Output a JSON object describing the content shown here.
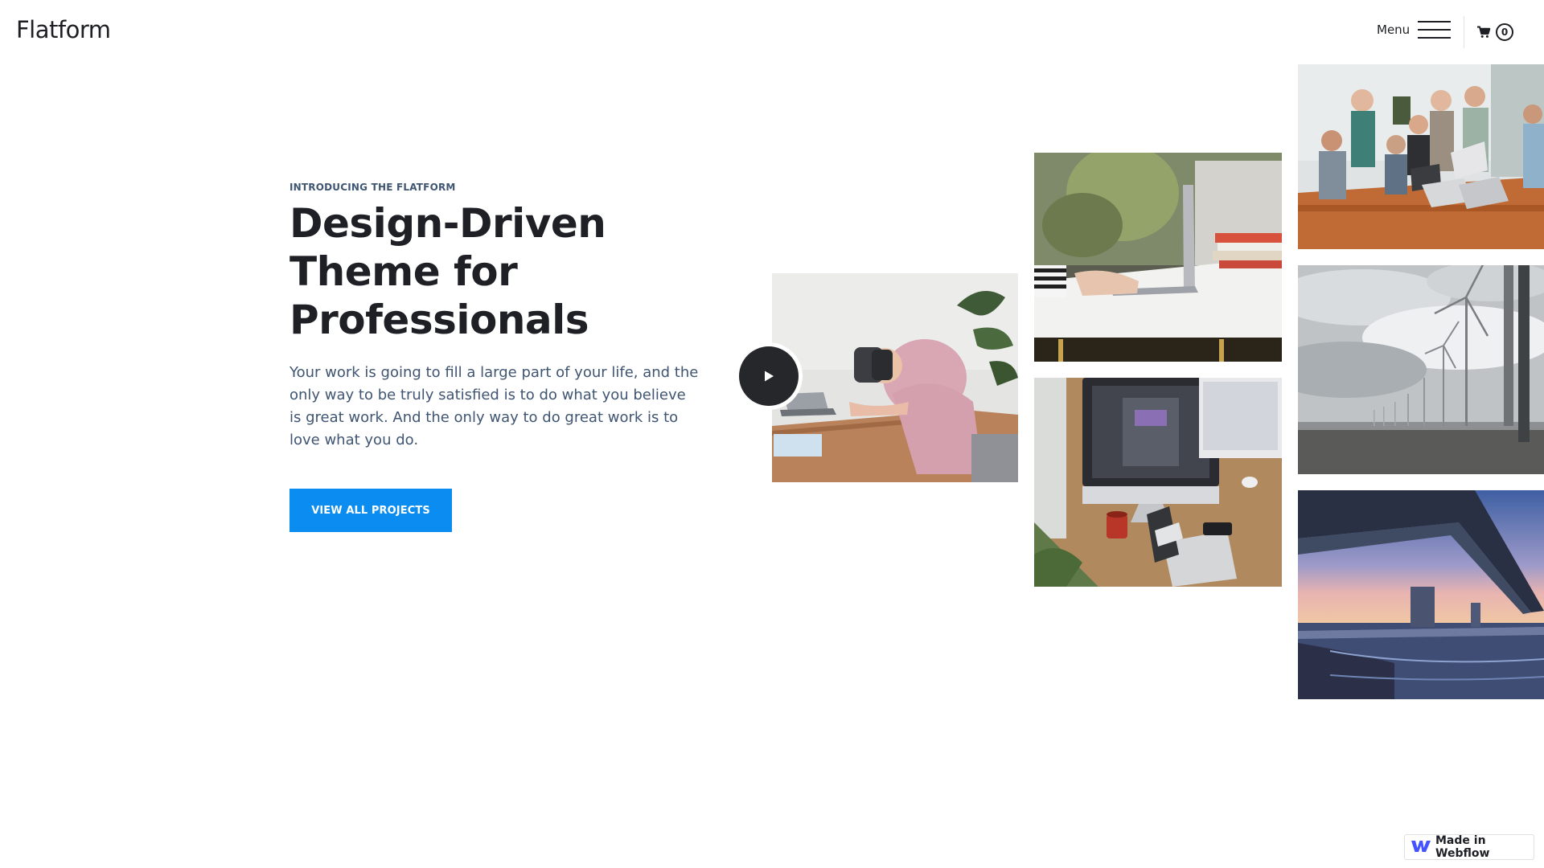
{
  "header": {
    "logo": "Flatform",
    "menu_label": "Menu",
    "cart_count": "0",
    "icons": [
      "hamburger-icon",
      "cart-icon"
    ]
  },
  "hero": {
    "eyebrow": "INTRODUCING THE FLATFORM",
    "title": "Design-Driven Theme for Professionals",
    "description": "Your work is going to fill a large part of your life, and the only way to be truly satisfied is to do what you believe is great work. And the only way to do great work is to love what you do.",
    "cta_label": "VIEW ALL PROJECTS"
  },
  "gallery": {
    "images": [
      "woman-vr-headset-desk",
      "hands-typing-laptop",
      "desk-imac-workspace",
      "team-meeting-table",
      "wind-turbines-coast",
      "bridge-sunset-sea"
    ],
    "play_icon": "play-icon"
  },
  "badge": {
    "label": "Made in Webflow",
    "icon": "webflow-logo-icon"
  },
  "colors": {
    "accent": "#0a8cf0",
    "heading": "#1f2025",
    "body_text": "#3f5572",
    "background": "#ffffff"
  }
}
